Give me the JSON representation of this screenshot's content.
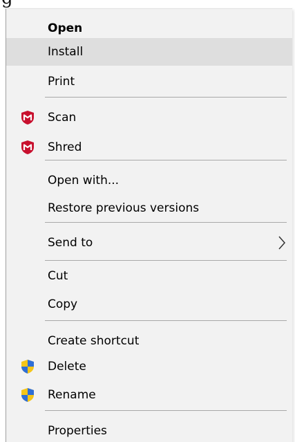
{
  "background": {
    "partial_text": "g"
  },
  "menu": {
    "open": "Open",
    "install": "Install",
    "print": "Print",
    "scan": "Scan",
    "shred": "Shred",
    "open_with": "Open with...",
    "restore_previous_versions": "Restore previous versions",
    "send_to": "Send to",
    "cut": "Cut",
    "copy": "Copy",
    "create_shortcut": "Create shortcut",
    "delete": "Delete",
    "rename": "Rename",
    "properties": "Properties"
  },
  "icons": {
    "scan": "mcafee-shield-icon",
    "shred": "mcafee-shield-icon",
    "delete": "uac-shield-icon",
    "rename": "uac-shield-icon",
    "send_to": "chevron-right-icon"
  },
  "colors": {
    "menu_background": "#f2f2f2",
    "hover_background": "#dedede",
    "separator": "#a8a8a8",
    "mcafee_red": "#c8102e",
    "uac_blue": "#2f6fd6",
    "uac_yellow": "#f5c518"
  },
  "state": {
    "highlighted_item": "Install"
  }
}
